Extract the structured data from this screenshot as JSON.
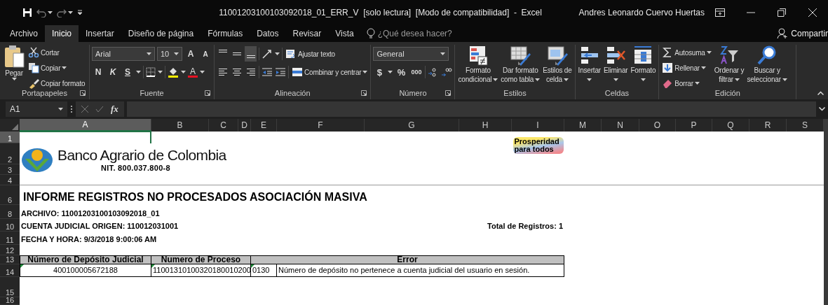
{
  "title_bar": {
    "title": "11001203100103092018_01_ERR_V  [solo lectura]  [Modo de compatibilidad]  -  Excel",
    "user": "Andres Leonardo Cuervo Huertas"
  },
  "tabs": [
    {
      "label": "Archivo",
      "selected": false
    },
    {
      "label": "Inicio",
      "selected": true
    },
    {
      "label": "Insertar",
      "selected": false
    },
    {
      "label": "Diseño de página",
      "selected": false
    },
    {
      "label": "Fórmulas",
      "selected": false
    },
    {
      "label": "Datos",
      "selected": false
    },
    {
      "label": "Revisar",
      "selected": false
    },
    {
      "label": "Vista",
      "selected": false
    }
  ],
  "tell_me": "¿Qué desea hacer?",
  "share": "Compartir",
  "ribbon": {
    "groups": [
      {
        "kind": "clipboard",
        "label": "Portapapeles",
        "launcher": true,
        "paste": "Pegar",
        "items": [
          {
            "label": "Cortar",
            "dropdown": false
          },
          {
            "label": "Copiar",
            "dropdown": true
          },
          {
            "label": "Copiar formato",
            "dropdown": false
          }
        ]
      },
      {
        "kind": "font",
        "label": "Fuente",
        "launcher": true,
        "font": "Arial",
        "size": "10",
        "grow": "A",
        "shrink": "A",
        "bold": "N",
        "italic": "K",
        "underline": "S",
        "font_color": "A"
      },
      {
        "kind": "alignment",
        "label": "Alineación",
        "launcher": true,
        "vertical": [
          {
            "selected": false
          },
          {
            "selected": false
          },
          {
            "selected": true
          }
        ],
        "wrap": "Ajustar texto",
        "merge": "Combinar y centrar"
      },
      {
        "kind": "number",
        "label": "Número",
        "launcher": true,
        "format": "General",
        "currency": "$",
        "percent": "%",
        "thousands": "000"
      },
      {
        "kind": "styles",
        "label": "Estilos",
        "launcher": false,
        "buttons": [
          {
            "lines": [
              "Formato",
              "condicional"
            ]
          },
          {
            "lines": [
              "Dar formato",
              "como tabla"
            ]
          },
          {
            "lines": [
              "Estilos de",
              "celda"
            ]
          }
        ]
      },
      {
        "kind": "cells",
        "label": "Celdas",
        "launcher": false,
        "buttons": [
          {
            "lines": [
              "Insertar"
            ]
          },
          {
            "lines": [
              "Eliminar"
            ]
          },
          {
            "lines": [
              "Formato"
            ]
          }
        ]
      },
      {
        "kind": "editing",
        "label": "Edición",
        "launcher": false,
        "items": [
          {
            "label": "Autosuma"
          },
          {
            "label": "Rellenar"
          },
          {
            "label": "Borrar"
          }
        ],
        "buttons": [
          {
            "lines": [
              "Ordenar y",
              "filtrar"
            ]
          },
          {
            "lines": [
              "Buscar y",
              "seleccionar"
            ]
          }
        ]
      }
    ]
  },
  "formula_bar": {
    "name_box": "A1",
    "fx": "fx"
  },
  "sheet": {
    "columns": [
      {
        "label": "A",
        "selected": true
      },
      {
        "label": "B",
        "selected": false
      },
      {
        "label": "C",
        "selected": false
      },
      {
        "label": "D",
        "selected": false
      },
      {
        "label": "E",
        "selected": false
      },
      {
        "label": "F",
        "selected": false
      },
      {
        "label": "G",
        "selected": false
      },
      {
        "label": "H",
        "selected": false
      },
      {
        "label": "I",
        "selected": false
      },
      {
        "label": "M",
        "selected": false
      },
      {
        "label": "N",
        "selected": false
      },
      {
        "label": "O",
        "selected": false
      },
      {
        "label": "P",
        "selected": false
      },
      {
        "label": "Q",
        "selected": false
      },
      {
        "label": "R",
        "selected": false
      },
      {
        "label": "S",
        "selected": false
      }
    ],
    "rows": [
      {
        "label": "1",
        "selected": true
      },
      {
        "label": "2",
        "selected": false
      },
      {
        "label": "3",
        "selected": false
      },
      {
        "label": "4",
        "selected": false
      },
      {
        "label": "6",
        "selected": false
      },
      {
        "label": "8",
        "selected": false
      },
      {
        "label": "10",
        "selected": false
      },
      {
        "label": "11",
        "selected": false
      },
      {
        "label": "12",
        "selected": false
      },
      {
        "label": "13",
        "selected": false
      },
      {
        "label": "14",
        "selected": false
      },
      {
        "label": "15",
        "selected": false
      },
      {
        "label": "16",
        "selected": false
      }
    ],
    "bank_logo": {
      "name": "Banco Agrario de Colombia",
      "nit": "NIT. 800.037.800-8"
    },
    "slogan": "Prosperidad para todos",
    "report_title": "INFORME REGISTROS NO PROCESADOS ASOCIACIÓN MASIVA",
    "file_line": "ARCHIVO: 11001203100103092018_01",
    "account_line": "CUENTA JUDICIAL ORIGEN: 110012031001",
    "date_line": "FECHA Y HORA: 9/3/2018 9:00:06 AM",
    "total": "Total de Registros: 1",
    "table": {
      "columns": [
        "Número de Depósito Judicial",
        "Numero de Proceso",
        "Error"
      ],
      "rows": [
        {
          "deposit": "400100005672188",
          "process": "11001310100320180010200",
          "code": "0130",
          "message": "Número de depósito no pertenece a cuenta judicial del usuario en sesión."
        }
      ]
    }
  }
}
